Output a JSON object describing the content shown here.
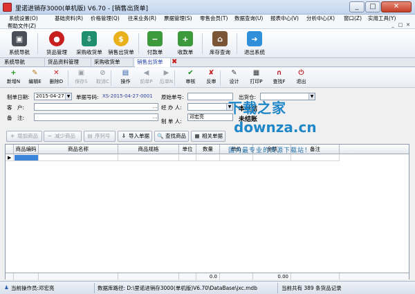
{
  "window": {
    "title": "里诺进销存3000(单机版) V6.70 - [销售出货单]",
    "minimize": "_",
    "maximize": "□",
    "close": "✕"
  },
  "menubar": {
    "items": [
      "系统设置(O)",
      "基础资料(R)",
      "价格管理(Q)",
      "往来业务(R)",
      "票据管理(S)",
      "零售会员(T)",
      "数据查询(U)",
      "报表中心(V)",
      "分析中心(X)",
      "窗口(Z)",
      "实用工具(Y)"
    ],
    "help": "帮助文件(Z)",
    "mdi_buttons": [
      "_",
      "□",
      "✕"
    ]
  },
  "toolbar1": [
    {
      "label": "系统导航",
      "icon": "system-navigation-icon"
    },
    {
      "label": "货品管理",
      "icon": "apple-goods-icon"
    },
    {
      "label": "采购收货单",
      "icon": "purchase-receipt-icon"
    },
    {
      "label": "销售出货单",
      "icon": "sales-delivery-icon"
    },
    {
      "label": "付款单",
      "icon": "payment-icon"
    },
    {
      "label": "收款单",
      "icon": "receipt-icon"
    },
    {
      "label": "库存查询",
      "icon": "warehouse-icon"
    },
    {
      "label": "退出系统",
      "icon": "exit-system-icon"
    }
  ],
  "tabs": [
    "系统导航",
    "货品资料管理",
    "采购收货单",
    "销售出货单"
  ],
  "toolbar2": [
    {
      "label": "新增N",
      "icon": "+",
      "enabled": true,
      "color": "#1a9a1a"
    },
    {
      "label": "编辑E",
      "icon": "✎",
      "enabled": true,
      "color": "#b47a1a"
    },
    {
      "label": "删除D",
      "icon": "✕",
      "enabled": true,
      "color": "#c42020"
    },
    {
      "label": "保存S",
      "icon": "▣",
      "enabled": false,
      "color": "#9aa0a8"
    },
    {
      "label": "取消C",
      "icon": "⊘",
      "enabled": false,
      "color": "#9aa0a8"
    },
    {
      "label": "操作",
      "icon": "▤",
      "enabled": true,
      "color": "#2a5aa8"
    },
    {
      "label": "前单P",
      "icon": "◀",
      "enabled": false,
      "color": "#9aa0a8"
    },
    {
      "label": "后单N",
      "icon": "▶",
      "enabled": false,
      "color": "#9aa0a8"
    },
    {
      "label": "审核",
      "icon": "✔",
      "enabled": true,
      "color": "#1a8a1a"
    },
    {
      "label": "反审",
      "icon": "✘",
      "enabled": true,
      "color": "#c42020"
    },
    {
      "label": "设计",
      "icon": "✎",
      "enabled": true,
      "color": "#444444"
    },
    {
      "label": "打印P",
      "icon": "▦",
      "enabled": true,
      "color": "#333333"
    },
    {
      "label": "查找F",
      "icon": "∩",
      "enabled": true,
      "color": "#b8232a"
    },
    {
      "label": "退出",
      "icon": "⏻",
      "enabled": true,
      "color": "#c42020"
    }
  ],
  "form": {
    "date_label": "制单日期:",
    "date_value": "2015-04-27",
    "order_no_label": "单据号码:",
    "order_no_value": "XS-2015-04-27-0001",
    "orig_no_label": "原始单号:",
    "orig_no_value": "",
    "warehouse_label": "出货仓:",
    "warehouse_value": "",
    "customer_label": "客　户:",
    "customer_value": "",
    "handler_label": "经 办 人:",
    "handler_value": "",
    "settle_label": "本单结",
    "note_label": "备　注:",
    "note_value": "",
    "maker_label": "制 单 人:",
    "maker_value": "邓宏亮",
    "unsettled_label": "未结账"
  },
  "actions": [
    {
      "label": "增加商品",
      "icon": "+",
      "enabled": false
    },
    {
      "label": "减少商品",
      "icon": "−",
      "enabled": false
    },
    {
      "label": "序列号",
      "icon": "▤",
      "enabled": false
    },
    {
      "label": "导入单据",
      "icon": "⇩",
      "enabled": true
    },
    {
      "label": "查找商品",
      "icon": "🔍",
      "enabled": true
    },
    {
      "label": "相关单据",
      "icon": "▦",
      "enabled": true
    }
  ],
  "grid": {
    "columns": [
      "商品编码",
      "商品名称",
      "商品规格",
      "单位",
      "数量",
      "单价",
      "金额",
      "备注"
    ],
    "footer": [
      "",
      "",
      "",
      "",
      "0.0",
      "",
      "0.00",
      ""
    ]
  },
  "status": {
    "operator": "当前操作员:邓宏亮",
    "db_path": "数据库路径: D:\\里诺进销存3000(单机版)V6.70\\DataBase\\jxc.mdb",
    "records": "当前共有 389 条货品记录"
  },
  "watermark": {
    "line1": "下载之家",
    "line2": "downza.cn",
    "line3": "国内最专业的资源下载站！"
  },
  "colors": {
    "accent": "#3b86db",
    "titlebar": "#c2d5ee",
    "watermark": "#1f86c8"
  }
}
